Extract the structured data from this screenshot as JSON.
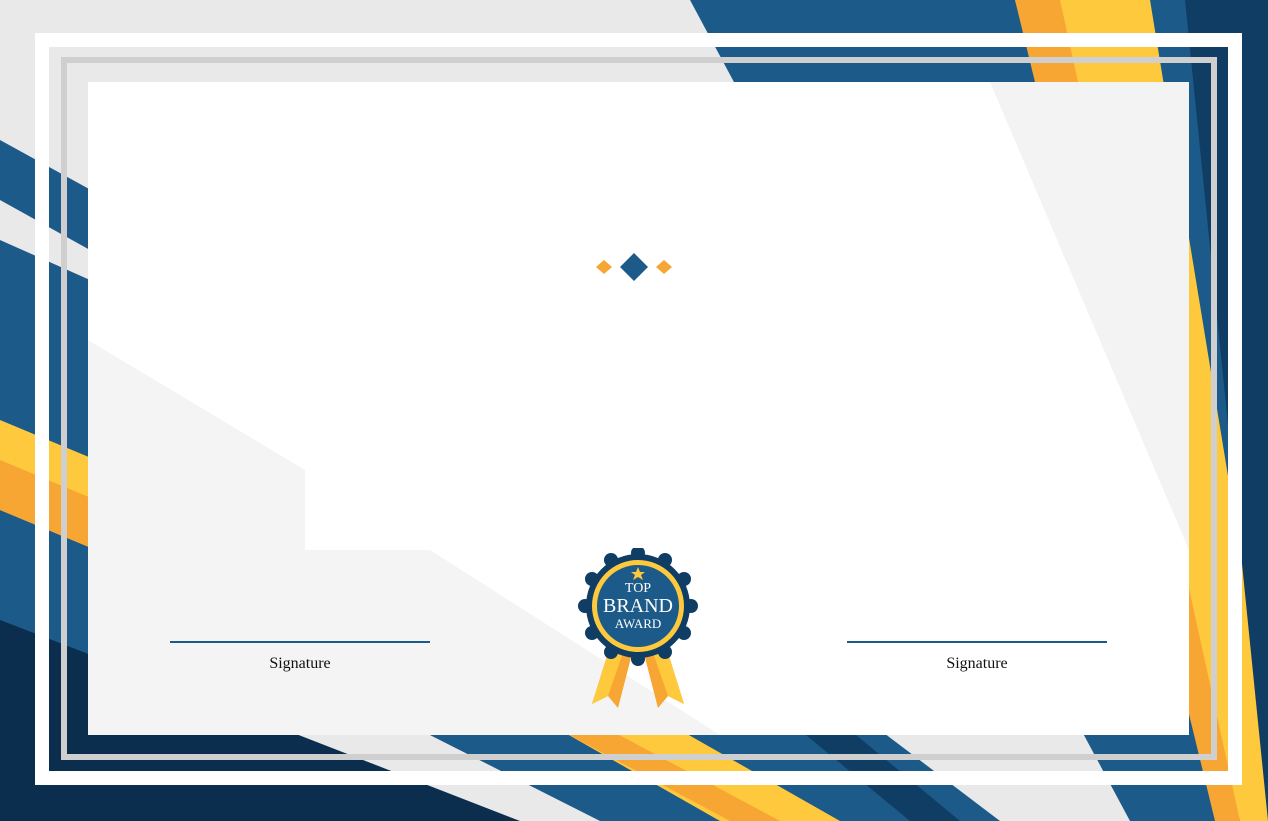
{
  "certificate": {
    "left_signature_label": "Signature",
    "right_signature_label": "Signature"
  },
  "badge": {
    "line1": "TOP",
    "line2": "BRAND",
    "line3": "AWARD"
  },
  "colors": {
    "navy": "#1c5a8a",
    "dark_navy": "#0b2d4e",
    "gold": "#fec93d",
    "orange": "#f7a533",
    "light_gray": "#e8e8e8",
    "panel": "#fafafa"
  }
}
